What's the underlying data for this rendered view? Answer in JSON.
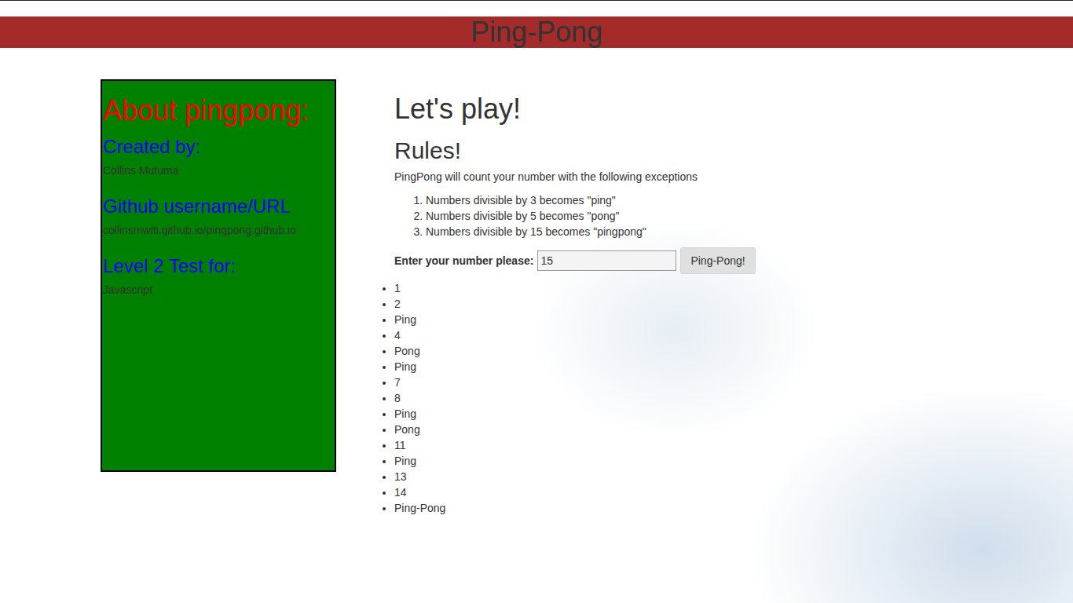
{
  "header": {
    "title": "Ping-Pong"
  },
  "about": {
    "title": "About pingpong:",
    "sections": [
      {
        "heading": "Created by:",
        "text": "Collins Mutuma"
      },
      {
        "heading": "Github username/URL",
        "text": "collinsmwiti.github.io/pingpong.github.io"
      },
      {
        "heading": "Level 2 Test for:",
        "text": "Javascript"
      }
    ]
  },
  "game": {
    "title": "Let's play!",
    "rules_title": "Rules!",
    "intro": "PingPong will count your number with the following exceptions",
    "rules": [
      "Numbers divisible by 3 becomes \"ping\"",
      "Numbers divisible by 5 becomes \"pong\"",
      "Numbers divisible by 15 becomes \"pingpong\""
    ],
    "label": "Enter your number please:",
    "input_value": "15",
    "button": "Ping-Pong!",
    "results": [
      "1",
      "2",
      "Ping",
      "4",
      "Pong",
      "Ping",
      "7",
      "8",
      "Ping",
      "Pong",
      "11",
      "Ping",
      "13",
      "14",
      "Ping-Pong"
    ]
  }
}
